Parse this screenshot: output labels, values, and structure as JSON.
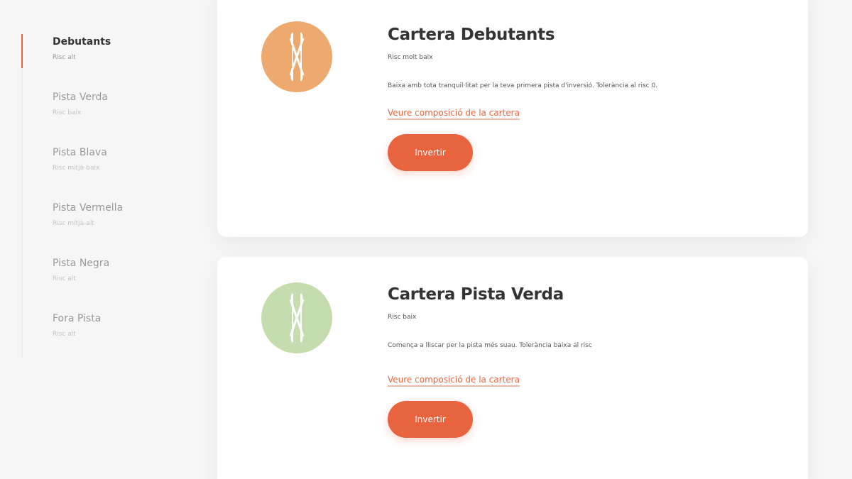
{
  "sidebar": {
    "items": [
      {
        "title": "Debutants",
        "subtitle": "Risc alt"
      },
      {
        "title": "Pista Verda",
        "subtitle": "Risc baix"
      },
      {
        "title": "Pista Blava",
        "subtitle": "Risc mitjà-baix"
      },
      {
        "title": "Pista Vermella",
        "subtitle": "Risc mitjà-alt"
      },
      {
        "title": "Pista Negra",
        "subtitle": "Risc alt"
      },
      {
        "title": "Fora Pista",
        "subtitle": "Risc alt"
      }
    ]
  },
  "cards": [
    {
      "title": "Cartera Debutants",
      "risk": "Risc molt baix",
      "description": "Baixa amb tota tranquil·litat per la teva primera pista d'inversió. Tolerància al risc 0.",
      "link": "Veure composició de la cartera",
      "button": "Invertir",
      "color": "#eda96e"
    },
    {
      "title": "Cartera Pista Verda",
      "risk": "Risc baix",
      "description": "Comença a lliscar per la pista més suau. Tolerància baixa al risc",
      "link": "Veure composició de la cartera",
      "button": "Invertir",
      "color": "#c5dcae"
    }
  ],
  "icons": {
    "card_logo": "crossed-skis-icon"
  },
  "colors": {
    "accent": "#e7643f",
    "link_underline": "#f3b9a5"
  }
}
